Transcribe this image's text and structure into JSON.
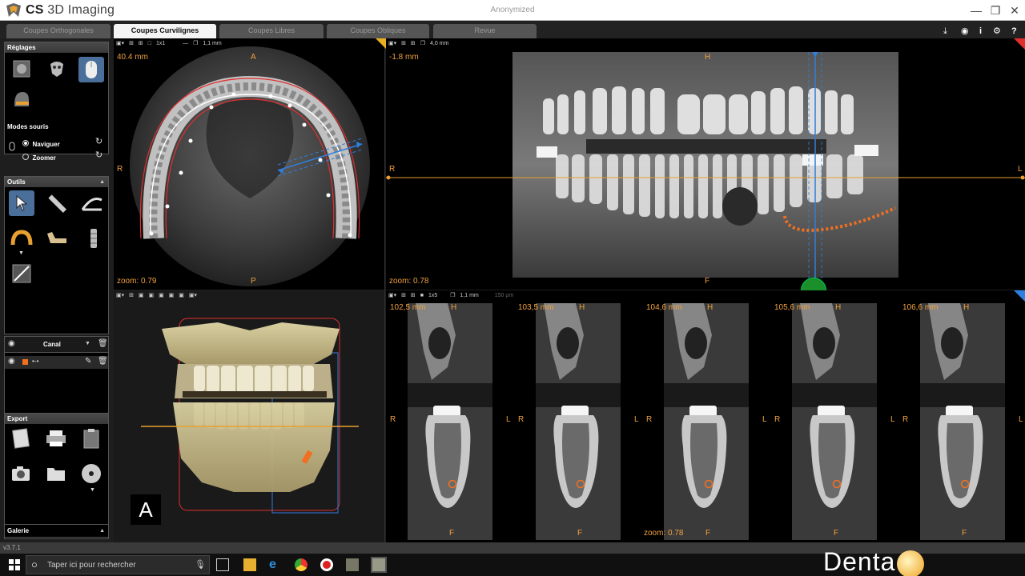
{
  "titlebar": {
    "app_brand": "CS",
    "app_name": "3D Imaging",
    "patient": "Anonymized"
  },
  "tabs": [
    {
      "label": "Coupes Orthogonales",
      "active": false
    },
    {
      "label": "Coupes Curvilignes",
      "active": true
    },
    {
      "label": "Coupes Libres",
      "active": false
    },
    {
      "label": "Coupes Obliques",
      "active": false
    },
    {
      "label": "Revue",
      "active": false
    }
  ],
  "left": {
    "reglages": {
      "title": "Réglages"
    },
    "mouse_modes": {
      "title": "Modes souris",
      "navigate": "Naviguer",
      "zoom": "Zoomer",
      "selected": "Naviguer"
    },
    "tools": {
      "title": "Outils"
    },
    "canal": {
      "label": "Canal"
    },
    "export": {
      "title": "Export"
    },
    "galerie": {
      "title": "Galerie"
    }
  },
  "axial": {
    "depth": "40.4 mm",
    "zoom": "zoom: 0.79",
    "orient_top": "A",
    "orient_bottom": "P",
    "orient_left": "R",
    "toolbar": {
      "layout": "1x1",
      "thickness": "1,1 mm"
    }
  },
  "panoramic": {
    "depth": "-1.8 mm",
    "zoom": "zoom: 0.78",
    "orient_top": "H",
    "orient_bottom": "F",
    "orient_left": "L",
    "orient_left2": "R",
    "orient_right": "L",
    "toolbar": {
      "thickness": "4,0 mm"
    }
  },
  "view3d": {
    "orient": "A"
  },
  "cross": {
    "toolbar": {
      "layout": "1x5",
      "thickness": "1,1 mm",
      "spacing": "150 µm"
    },
    "zoom": "zoom: 0.78",
    "slices": [
      {
        "pos": "102,5 mm",
        "top": "H",
        "bottom": "F",
        "left": "R",
        "right": "L"
      },
      {
        "pos": "103,5 mm",
        "top": "H",
        "bottom": "F",
        "left": "R",
        "right": "L"
      },
      {
        "pos": "104,6 mm",
        "top": "H",
        "bottom": "F",
        "left": "R",
        "right": "L"
      },
      {
        "pos": "105,6 mm",
        "top": "H",
        "bottom": "F",
        "left": "R",
        "right": "L"
      },
      {
        "pos": "106,6 mm",
        "top": "H",
        "bottom": "F",
        "left": "R",
        "right": "L"
      }
    ]
  },
  "statusbar": {
    "version": "v3.7.1"
  },
  "taskbar": {
    "search_placeholder": "Taper ici pour rechercher",
    "brand_watermark": "Denta"
  },
  "colors": {
    "accent": "#f0a040",
    "selected_tool": "#4a6f9a",
    "guide_blue": "#2d7fe0",
    "curve_red": "#e03030",
    "handle_green": "#1a8f2a"
  }
}
